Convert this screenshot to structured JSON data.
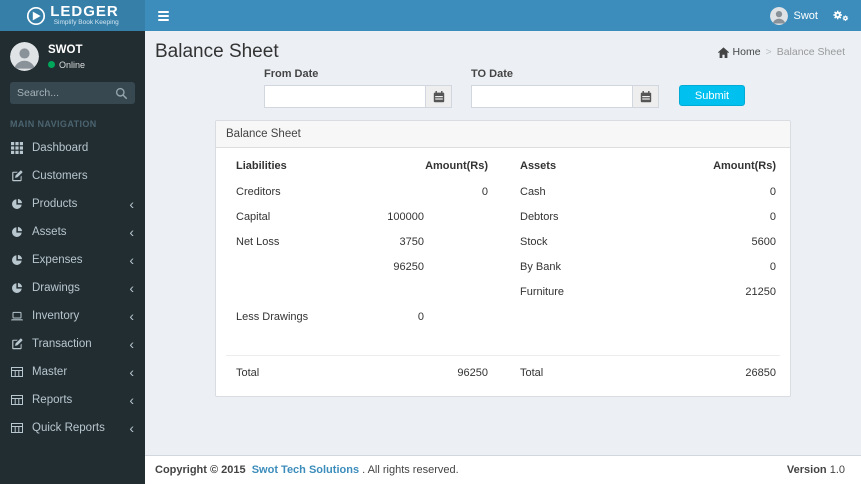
{
  "colors": {
    "navbar": "#3c8dbc",
    "logo-bg": "#367fa9",
    "sidebar-bg": "#222d32",
    "sidebar-text": "#b8c7ce",
    "accent": "#00c0ef",
    "online": "#00a65a",
    "link": "#3c8dbc",
    "content-bg": "#ecf0f5"
  },
  "brand": {
    "name": "LEDGER",
    "tagline": "Simplify Book Keeping"
  },
  "navbar": {
    "user_name": "Swot"
  },
  "sidebar": {
    "user": {
      "name": "SWOT",
      "status": "Online"
    },
    "search_placeholder": "Search...",
    "section_label": "MAIN NAVIGATION",
    "items": [
      {
        "label": "Dashboard",
        "icon": "th-grid-icon",
        "expandable": false
      },
      {
        "label": "Customers",
        "icon": "edit-icon",
        "expandable": false
      },
      {
        "label": "Products",
        "icon": "pie-chart-icon",
        "expandable": true
      },
      {
        "label": "Assets",
        "icon": "pie-chart-icon",
        "expandable": true
      },
      {
        "label": "Expenses",
        "icon": "pie-chart-icon",
        "expandable": true
      },
      {
        "label": "Drawings",
        "icon": "pie-chart-icon",
        "expandable": true
      },
      {
        "label": "Inventory",
        "icon": "laptop-icon",
        "expandable": true
      },
      {
        "label": "Transaction",
        "icon": "edit-icon",
        "expandable": true
      },
      {
        "label": "Master",
        "icon": "table-icon",
        "expandable": true
      },
      {
        "label": "Reports",
        "icon": "table-icon",
        "expandable": true
      },
      {
        "label": "Quick Reports",
        "icon": "table-icon",
        "expandable": true
      }
    ],
    "chevron": "‹"
  },
  "page": {
    "title": "Balance Sheet",
    "breadcrumb": {
      "home_label": "Home",
      "separator": ">",
      "current": "Balance Sheet"
    }
  },
  "filter": {
    "from_label": "From Date",
    "from_value": "",
    "to_label": "TO Date",
    "to_value": "",
    "submit_label": "Submit"
  },
  "panel": {
    "title": "Balance Sheet",
    "table": {
      "headers": [
        "Liabilities",
        "Amount(Rs)",
        "Assets",
        "Amount(Rs)"
      ],
      "rows": [
        {
          "liability": "Creditors",
          "liability_amount": "0",
          "liability_align": "outer",
          "asset": "Cash",
          "asset_amount": "0"
        },
        {
          "liability": "Capital",
          "liability_amount": "100000",
          "liability_align": "inner",
          "asset": "Debtors",
          "asset_amount": "0"
        },
        {
          "liability": "Net Loss",
          "liability_amount": "3750",
          "liability_align": "inner",
          "asset": "Stock",
          "asset_amount": "5600"
        },
        {
          "liability": "",
          "liability_amount": "96250",
          "liability_align": "inner",
          "asset": "By Bank",
          "asset_amount": "0"
        },
        {
          "liability": "",
          "liability_amount": "",
          "liability_align": "inner",
          "asset": "Furniture",
          "asset_amount": "21250"
        },
        {
          "liability": "Less Drawings",
          "liability_amount": "0",
          "liability_align": "inner",
          "asset": "",
          "asset_amount": ""
        },
        {
          "liability": "",
          "liability_amount": "",
          "liability_align": "inner",
          "asset": "",
          "asset_amount": ""
        }
      ],
      "total_row": {
        "liability": "Total",
        "liability_amount": "96250",
        "asset": "Total",
        "asset_amount": "26850"
      }
    }
  },
  "footer": {
    "copyright_bold": "Copyright © 2015",
    "company_link": "Swot Tech Solutions",
    "rights": ". All rights reserved.",
    "version_label": "Version",
    "version_value": "1.0"
  }
}
